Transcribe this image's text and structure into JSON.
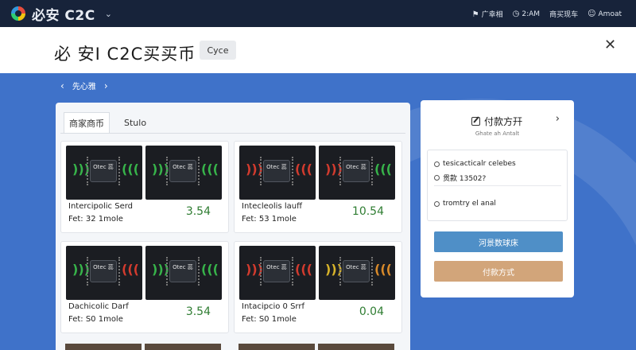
{
  "app": {
    "title": "必安 C2C"
  },
  "status_bar": {
    "item1": "广幸相",
    "time": "2:AM",
    "item3": "商买现车",
    "user": "Amoat"
  },
  "header": {
    "title": "必 安I C2C买买币",
    "cycle_button": "Cyce"
  },
  "nav": {
    "label": "先心雅"
  },
  "tabs": [
    {
      "label": "商家商币"
    },
    {
      "label": "Stulo"
    }
  ],
  "listings": [
    {
      "name": "Intercipolic Serd",
      "meta": "Fet: 32 1mole",
      "price": "3.54",
      "chip_label": "Otec 蕊"
    },
    {
      "name": "Intecleolis lauff",
      "meta": "Fet: 53 1mole",
      "price": "10.54",
      "chip_label": "Otec 蕊"
    },
    {
      "name": "Dachicolic Darf",
      "meta": "Fet: S0 1mole",
      "price": "3.54",
      "chip_label": "Otec 蕊"
    },
    {
      "name": "Intacipcio 0 Srrf",
      "meta": "Fet: S0 1mole",
      "price": "0.04",
      "chip_label": "Otec 蕊"
    }
  ],
  "payment": {
    "title": "付款方幵",
    "subtitle": "Ghate ah Antalt",
    "info_line1": "tesicacticalr celebes",
    "info_line2": "贯款 13502?",
    "info_line3": "tromtry el anal",
    "primary_button": "河景数球床",
    "secondary_button": "付款方式"
  },
  "colors": {
    "price_green": "#2f7d32",
    "brand_blue": "#3f72c9",
    "button_blue": "#4f8fc7",
    "button_tan": "#d2a57a"
  }
}
